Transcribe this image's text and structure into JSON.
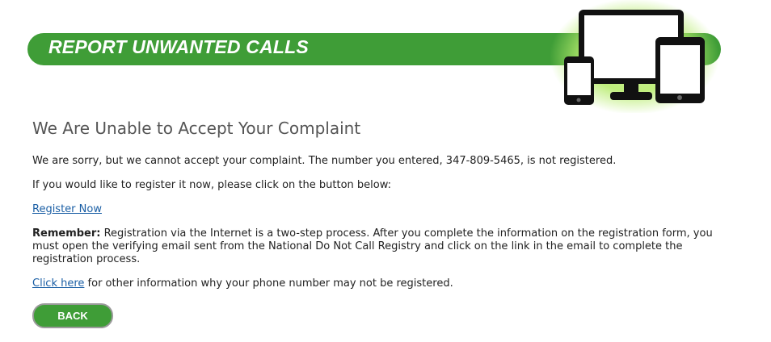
{
  "banner": {
    "title": "REPORT UNWANTED CALLS",
    "color": "#3f9d37",
    "icon": "devices-icon"
  },
  "main": {
    "heading": "We Are Unable to Accept Your Complaint",
    "sorry_text": "We are sorry, but we cannot accept your complaint. The number you entered, 347-809-5465, is not registered.",
    "register_prompt": "If you would like to register it now, please click on the button below:",
    "register_link": "Register Now",
    "remember_label": "Remember:",
    "remember_text": " Registration via the Internet is a two-step process. After you complete the information on the registration form, you must open the verifying email sent from the National Do Not Call Registry and click on the link in the email to complete the registration process.",
    "click_here_link": "Click here",
    "click_here_text": " for other information why your phone number may not be registered.",
    "back_button": "BACK"
  },
  "colors": {
    "accent_green": "#3f9d37",
    "link_blue": "#1b5fa5",
    "heading_gray": "#555555"
  }
}
